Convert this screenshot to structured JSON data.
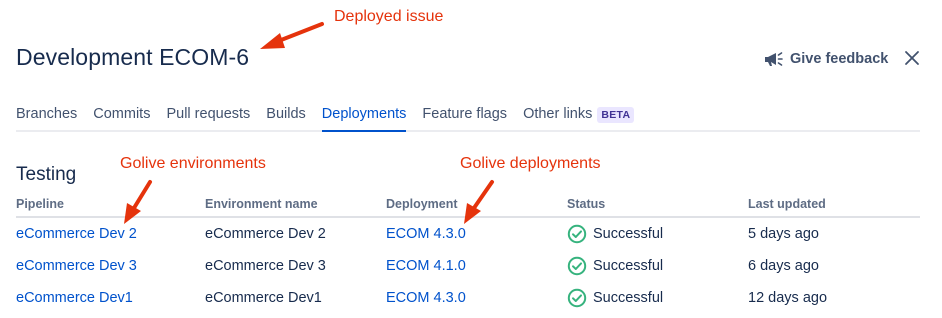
{
  "header": {
    "title": "Development ECOM-6",
    "feedback_label": "Give feedback"
  },
  "tabs": [
    {
      "label": "Branches",
      "active": false
    },
    {
      "label": "Commits",
      "active": false
    },
    {
      "label": "Pull requests",
      "active": false
    },
    {
      "label": "Builds",
      "active": false
    },
    {
      "label": "Deployments",
      "active": true
    },
    {
      "label": "Feature flags",
      "active": false
    },
    {
      "label": "Other links",
      "active": false,
      "badge": "BETA"
    }
  ],
  "section": {
    "title": "Testing",
    "columns": [
      "Pipeline",
      "Environment name",
      "Deployment",
      "Status",
      "Last updated"
    ],
    "rows": [
      {
        "pipeline": "eCommerce Dev 2",
        "environment": "eCommerce Dev 2",
        "deployment": "ECOM 4.3.0",
        "status": "Successful",
        "updated": "5 days ago"
      },
      {
        "pipeline": "eCommerce Dev 3",
        "environment": "eCommerce Dev 3",
        "deployment": "ECOM 4.1.0",
        "status": "Successful",
        "updated": "6 days ago"
      },
      {
        "pipeline": "eCommerce Dev1",
        "environment": "eCommerce Dev1",
        "deployment": "ECOM 4.3.0",
        "status": "Successful",
        "updated": "12 days ago"
      }
    ]
  },
  "annotations": {
    "deployed_issue": "Deployed issue",
    "golive_environments": "Golive environments",
    "golive_deployments": "Golive deployments"
  },
  "colors": {
    "link": "#0052cc",
    "success": "#36b37e",
    "annotation": "#e5330c",
    "text": "#172b4d"
  },
  "icons": {
    "feedback": "megaphone-icon",
    "close": "close-icon",
    "status": "check-circle-icon"
  }
}
